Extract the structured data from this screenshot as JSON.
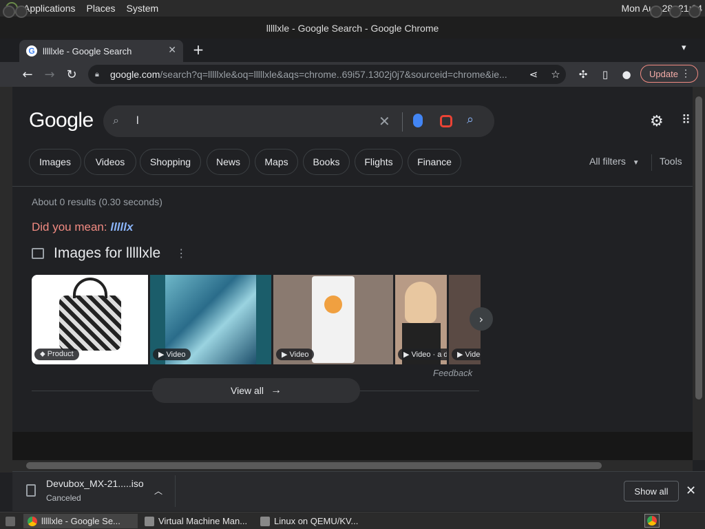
{
  "desktop": {
    "menus": [
      "Applications",
      "Places",
      "System"
    ],
    "clock": "Mon Aug 28, 21:34"
  },
  "window": {
    "title": "lllllxle - Google Search - Google Chrome"
  },
  "tab": {
    "title": "lllllxle - Google Search",
    "favicon_letter": "G"
  },
  "address_bar": {
    "host": "google.com",
    "path": "/search?q=lllllxle&oq=lllllxle&aqs=chrome..69i57.1302j0j7&sourceid=chrome&ie..."
  },
  "toolbar": {
    "update_label": "Update"
  },
  "google": {
    "logo": "Google",
    "search_value": "l",
    "chips": [
      "Images",
      "Videos",
      "Shopping",
      "News",
      "Maps",
      "Books",
      "Flights",
      "Finance"
    ],
    "all_filters": "All filters",
    "tools": "Tools",
    "result_stats": "About 0 results (0.30 seconds)",
    "did_you_mean_label": "Did you mean:",
    "did_you_mean_suggestion": "lllllx",
    "images_heading": "Images for lllllxle",
    "image_tags": [
      "Product",
      "Video",
      "Video",
      "Video · a d",
      "Video"
    ],
    "feedback": "Feedback",
    "view_all": "View all"
  },
  "download": {
    "filename": "Devubox_MX-21.....iso",
    "status": "Canceled",
    "show_all": "Show all"
  },
  "taskbar": {
    "items": [
      "lllllxle - Google Se...",
      "Virtual Machine Man...",
      "Linux on QEMU/KV..."
    ]
  },
  "colors": {
    "page_bg": "#202124",
    "accent_blue": "#8ab4f8",
    "suggestion_red": "#f28b82"
  }
}
